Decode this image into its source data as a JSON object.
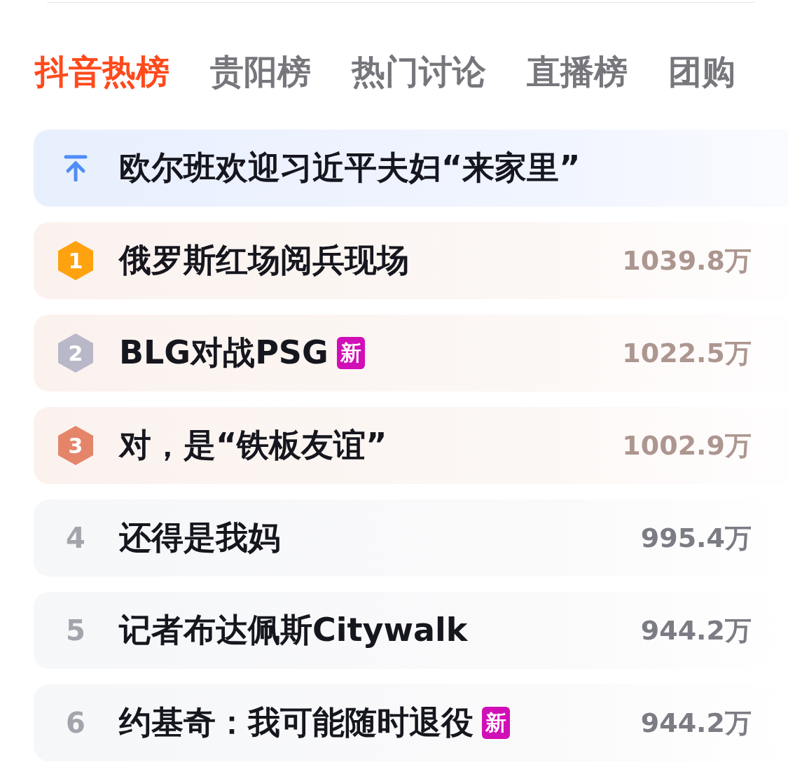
{
  "tabs": [
    {
      "label": "抖音热榜",
      "selected": true
    },
    {
      "label": "贵阳榜",
      "selected": false
    },
    {
      "label": "热门讨论",
      "selected": false
    },
    {
      "label": "直播榜",
      "selected": false
    },
    {
      "label": "团购",
      "selected": false
    }
  ],
  "items": [
    {
      "kind": "pinned",
      "title": "欧尔班欢迎习近平夫妇“来家里”"
    },
    {
      "kind": "medal",
      "rank": "1",
      "color": "#ffa20f",
      "title": "俄罗斯红场阅兵现场",
      "heat": "1039.8万",
      "is_new": false
    },
    {
      "kind": "medal",
      "rank": "2",
      "color": "#b9b8c9",
      "title": "BLG对战PSG",
      "heat": "1022.5万",
      "is_new": true,
      "badge": "新"
    },
    {
      "kind": "medal",
      "rank": "3",
      "color": "#e4856a",
      "title": "对，是“铁板友谊”",
      "heat": "1002.9万",
      "is_new": false
    },
    {
      "kind": "plain",
      "rank": "4",
      "title": "还得是我妈",
      "heat": "995.4万",
      "is_new": false
    },
    {
      "kind": "plain",
      "rank": "5",
      "title": "记者布达佩斯Citywalk",
      "heat": "944.2万",
      "is_new": false
    },
    {
      "kind": "plain",
      "rank": "6",
      "title": "约基奇：我可能随时退役",
      "heat": "944.2万",
      "is_new": true,
      "badge": "新"
    }
  ]
}
